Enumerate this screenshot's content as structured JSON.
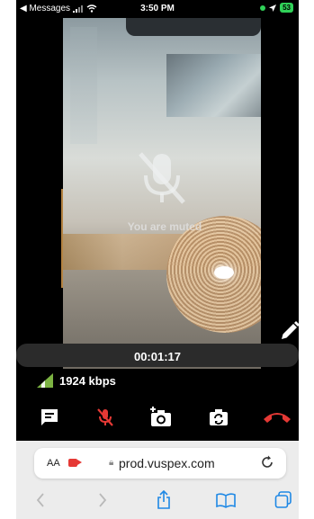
{
  "status_bar": {
    "back_app": "◀ Messages",
    "time": "3:50 PM",
    "battery": "53"
  },
  "call": {
    "muted_message": "You are muted",
    "timer": "00:01:17",
    "bitrate": "1924 kbps"
  },
  "controls": {
    "icons": [
      "chat-icon",
      "microphone-muted-icon",
      "camera-add-icon",
      "camera-switch-icon",
      "end-call-icon"
    ],
    "mute_color": "#e53935",
    "end_call_color": "#e53935"
  },
  "browser": {
    "text_size_label": "AA",
    "url": "prod.vuspex.com"
  }
}
